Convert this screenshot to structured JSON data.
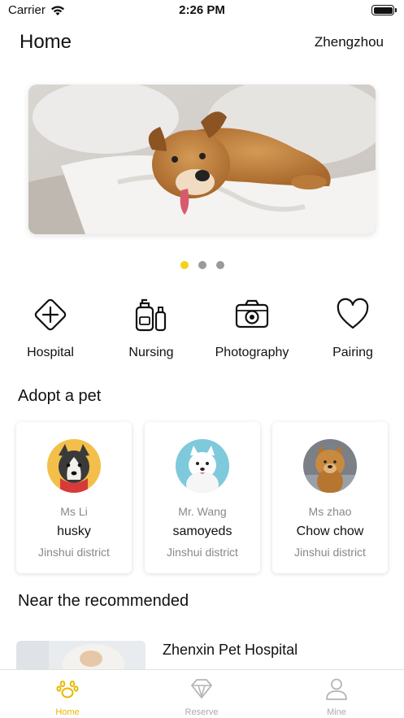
{
  "status_bar": {
    "carrier": "Carrier",
    "time": "2:26 PM"
  },
  "header": {
    "title": "Home",
    "city": "Zhengzhou"
  },
  "banner": {
    "page_count": 3,
    "active_page": 1
  },
  "categories": [
    {
      "label": "Hospital",
      "icon": "hospital-cross-icon"
    },
    {
      "label": "Nursing",
      "icon": "nursing-bottles-icon"
    },
    {
      "label": "Photography",
      "icon": "camera-icon"
    },
    {
      "label": "Pairing",
      "icon": "heart-icon"
    }
  ],
  "adopt": {
    "title": "Adopt a pet",
    "pets": [
      {
        "owner": "Ms Li",
        "breed": "husky",
        "district": "Jinshui district"
      },
      {
        "owner": "Mr. Wang",
        "breed": "samoyeds",
        "district": "Jinshui district"
      },
      {
        "owner": "Ms zhao",
        "breed": "Chow chow",
        "district": "Jinshui district"
      }
    ]
  },
  "recommended": {
    "title": "Near the recommended",
    "items": [
      {
        "name": "Zhenxin Pet Hospital"
      }
    ]
  },
  "tabbar": {
    "tabs": [
      {
        "label": "Home",
        "icon": "paw-icon",
        "active": true
      },
      {
        "label": "Reserve",
        "icon": "diamond-icon",
        "active": false
      },
      {
        "label": "Mine",
        "icon": "person-icon",
        "active": false
      }
    ]
  },
  "colors": {
    "accent": "#f5d21a",
    "tab_active": "#e8b800",
    "muted_text": "#888888"
  }
}
